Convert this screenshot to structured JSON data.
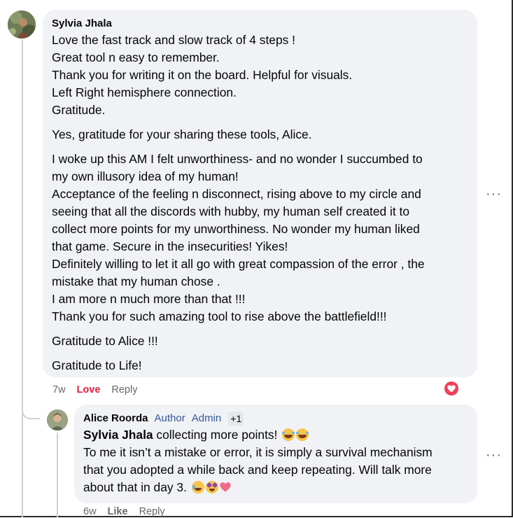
{
  "comment": {
    "author": "Sylvia Jhala",
    "paragraphs": [
      [
        "Love the fast track and slow track of 4 steps !",
        "Great tool n easy to remember.",
        "Thank you for writing it on the board. Helpful for visuals.",
        "Left Right hemisphere connection.",
        "Gratitude."
      ],
      [
        "Yes, gratitude for your sharing these tools, Alice."
      ],
      [
        "I woke up this AM I felt unworthiness- and no wonder I succumbed to",
        "my own illusory idea of my human!",
        "Acceptance of the feeling n disconnect, rising above to my circle and",
        "seeing that all the discords with hubby, my human self created it to",
        "collect more points for my unworthiness. No wonder my human liked",
        "that game. Secure in the insecurities! Yikes!",
        "Definitely willing to let it all go with great compassion of the error , the",
        "mistake that my human chose .",
        "I am more n much more than that !!!",
        "Thank you for such amazing tool to rise above the battlefield!!!"
      ],
      [
        "Gratitude to Alice !!!"
      ],
      [
        "Gratitude to Life!"
      ]
    ],
    "time": "7w",
    "reaction_label": "Love",
    "reply_label": "Reply",
    "more_label": "···",
    "reaction_color": "#e41e3f",
    "reaction_icon": "heart-icon"
  },
  "reply": {
    "author": "Alice Roorda",
    "badges": [
      "Author",
      "Admin"
    ],
    "badge_extra": "+1",
    "mention": "Sylvia Jhala",
    "first_line_rest": " collecting more points! ",
    "lines": [
      "To me it isn’t a mistake or error, it is simply a survival mechanism",
      "that you adopted a while back and keep repeating. Will talk more"
    ],
    "last_line": "about that in day 3. ",
    "time": "6w",
    "like_label": "Like",
    "reply_label": "Reply",
    "more_label": "···",
    "emojis_line1": [
      "laughing-crying-emoji",
      "laughing-crying-emoji"
    ],
    "emojis_last": [
      "crying-smile-emoji",
      "star-struck-emoji",
      "heart-emoji"
    ]
  }
}
